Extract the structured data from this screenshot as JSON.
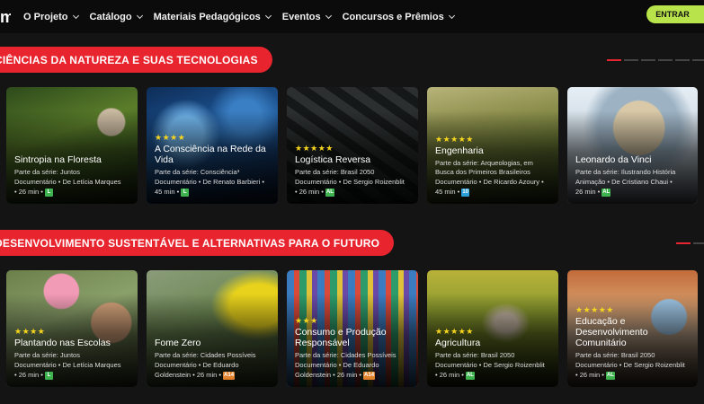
{
  "nav": {
    "logo": "m",
    "items": [
      {
        "label": "O Projeto",
        "key": "projeto"
      },
      {
        "label": "Catálogo",
        "key": "catalogo"
      },
      {
        "label": "Materiais Pedagógicos",
        "key": "materiais"
      },
      {
        "label": "Eventos",
        "key": "eventos"
      },
      {
        "label": "Concursos e Prêmios",
        "key": "concursos"
      }
    ],
    "login_label": "ENTRAR"
  },
  "sections": [
    {
      "title": "CIÊNCIAS DA NATUREZA E SUAS TECNOLOGIAS",
      "cards": [
        {
          "stars": "",
          "title": "Sintropia na Floresta",
          "series": "Parte da série: Juntos",
          "meta1": "Documentário • De Letícia Marques",
          "duration": "• 26 min •",
          "badge": "L",
          "badge_color": "green"
        },
        {
          "stars": "★★★★",
          "title": "A Consciência na Rede da Vida",
          "series": "Parte da série: Consciência³",
          "meta1": "Documentário • De Renato Barbieri •",
          "duration": "45 min •",
          "badge": "L",
          "badge_color": "green"
        },
        {
          "stars": "★★★★★",
          "title": "Logística Reversa",
          "series": "Parte da série: Brasil 2050",
          "meta1": "Documentário • De Sergio Roizenblit",
          "duration": "• 26 min •",
          "badge": "AL",
          "badge_color": "green"
        },
        {
          "stars": "★★★★★",
          "title": "Engenharia",
          "series": "Parte da série: Arqueologias, em Busca dos Primeiros Brasileiros",
          "meta1": "Documentário • De Ricardo Azoury •",
          "duration": "45 min •",
          "badge": "10",
          "badge_color": "blue"
        },
        {
          "stars": "",
          "title": "Leonardo da Vinci",
          "series": "Parte da série: Ilustrando História",
          "meta1": "Animação • De Cristiano Chaui •",
          "duration": "26 min •",
          "badge": "AL",
          "badge_color": "green"
        }
      ]
    },
    {
      "title": "DESENVOLVIMENTO SUSTENTÁVEL E ALTERNATIVAS PARA O FUTURO",
      "cards": [
        {
          "stars": "★★★★",
          "title": "Plantando nas Escolas",
          "series": "Parte da série: Juntos",
          "meta1": "Documentário • De Letícia Marques",
          "duration": "• 26 min •",
          "badge": "L",
          "badge_color": "green"
        },
        {
          "stars": "",
          "title": "Fome Zero",
          "series": "Parte da série: Cidades Possíveis",
          "meta1": "Documentário • De Eduardo",
          "duration": "Goldenstein • 26 min •",
          "badge": "A14",
          "badge_color": "orange"
        },
        {
          "stars": "★★★",
          "title": "Consumo e Produção Responsável",
          "series": "Parte da série: Cidades Possíveis",
          "meta1": "Documentário • De Eduardo",
          "duration": "Goldenstein • 26 min •",
          "badge": "A14",
          "badge_color": "orange"
        },
        {
          "stars": "★★★★★",
          "title": "Agricultura",
          "series": "Parte da série: Brasil 2050",
          "meta1": "Documentário • De Sergio Roizenblit",
          "duration": "• 26 min •",
          "badge": "AL",
          "badge_color": "green"
        },
        {
          "stars": "★★★★★",
          "title": "Educação e Desenvolvimento Comunitário",
          "series": "Parte da série: Brasil 2050",
          "meta1": "Documentário • De Sergio Roizenblit",
          "duration": "• 26 min •",
          "badge": "AL",
          "badge_color": "green"
        }
      ]
    }
  ]
}
